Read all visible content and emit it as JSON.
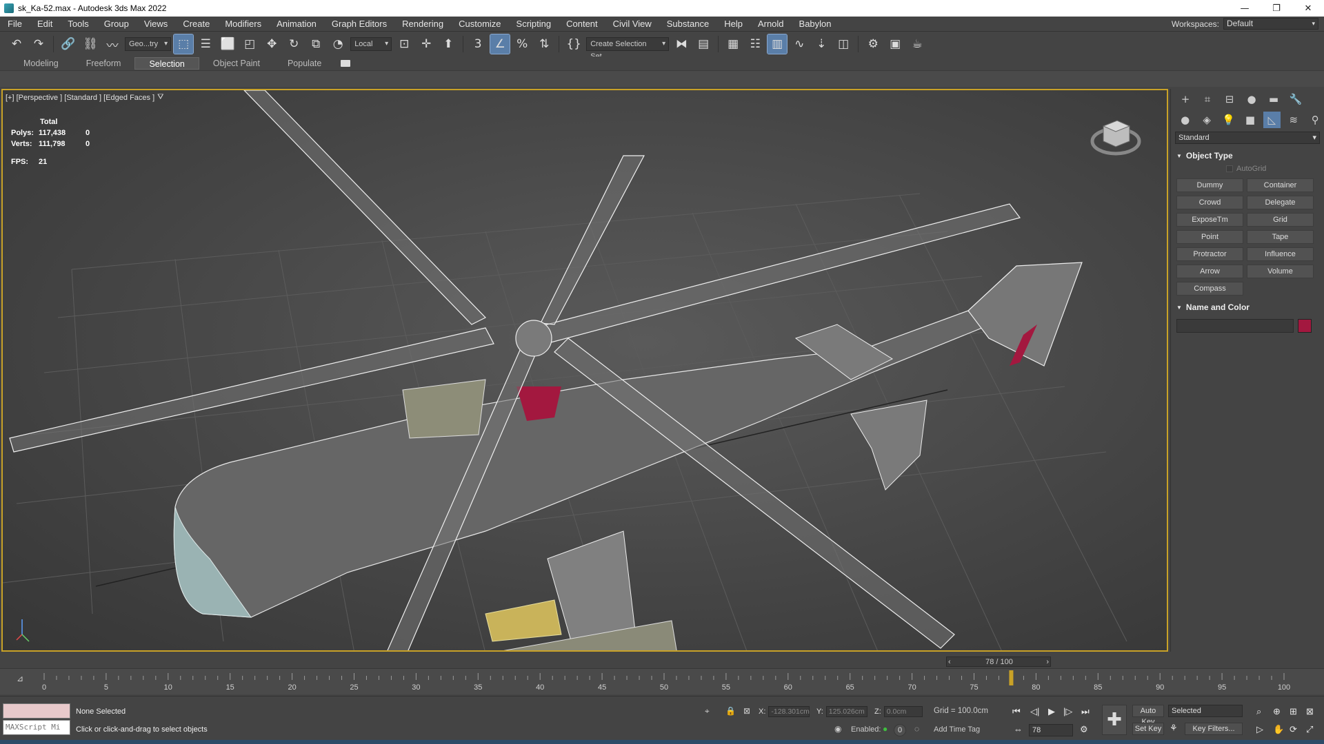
{
  "window": {
    "title": "sk_Ka-52.max - Autodesk 3ds Max 2022",
    "controls": [
      "—",
      "❐",
      "✕"
    ]
  },
  "menu": [
    "File",
    "Edit",
    "Tools",
    "Group",
    "Views",
    "Create",
    "Modifiers",
    "Animation",
    "Graph Editors",
    "Rendering",
    "Customize",
    "Scripting",
    "Content",
    "Civil View",
    "Substance",
    "Help",
    "Arnold",
    "Babylon"
  ],
  "workspace": {
    "label": "Workspaces:",
    "value": "Default"
  },
  "toolbar": {
    "selection_filter": "Geo...try",
    "ref_coord": "Local",
    "named_selection": "Create Selection Set"
  },
  "ribbon": {
    "tabs": [
      "Modeling",
      "Freeform",
      "Selection",
      "Object Paint",
      "Populate"
    ],
    "active": "Selection"
  },
  "viewport": {
    "label": "[+] [Perspective ] [Standard ] [Edged Faces ]",
    "stats": {
      "header": "Total",
      "polys_label": "Polys:",
      "polys_total": "117,438",
      "polys_sel": "0",
      "verts_label": "Verts:",
      "verts_total": "111,798",
      "verts_sel": "0",
      "fps_label": "FPS:",
      "fps_value": "21"
    },
    "border_color": "#c9a227"
  },
  "command_panel": {
    "category": "Standard",
    "object_type_title": "Object Type",
    "autogrid_label": "AutoGrid",
    "buttons": [
      "Dummy",
      "Container",
      "Crowd",
      "Delegate",
      "ExposeTm",
      "Grid",
      "Point",
      "Tape",
      "Protractor",
      "Influence",
      "Arrow",
      "Volume",
      "Compass"
    ],
    "name_color_title": "Name and Color",
    "swatch_color": "#a3183f"
  },
  "time": {
    "slider_label": "78 / 100",
    "current_frame": 78,
    "start": 0,
    "end": 100,
    "ticks": [
      "0",
      "5",
      "10",
      "15",
      "20",
      "25",
      "30",
      "35",
      "40",
      "45",
      "50",
      "55",
      "60",
      "65",
      "70",
      "75",
      "80",
      "85",
      "90",
      "95",
      "100"
    ]
  },
  "status": {
    "selection": "None Selected",
    "hint": "Click or click-and-drag to select objects",
    "maxscript": "MAXScript Mi",
    "x_label": "X:",
    "x_value": "-128.301cm",
    "y_label": "Y:",
    "y_value": "125.026cm",
    "z_label": "Z:",
    "z_value": "0.0cm",
    "grid": "Grid = 100.0cm",
    "enabled_label": "Enabled:",
    "enabled_value": "0",
    "add_time_tag": "Add Time Tag",
    "auto_key": "Auto Key",
    "selected": "Selected",
    "set_key": "Set Key",
    "key_filters": "Key Filters...",
    "frame_field": "78"
  }
}
